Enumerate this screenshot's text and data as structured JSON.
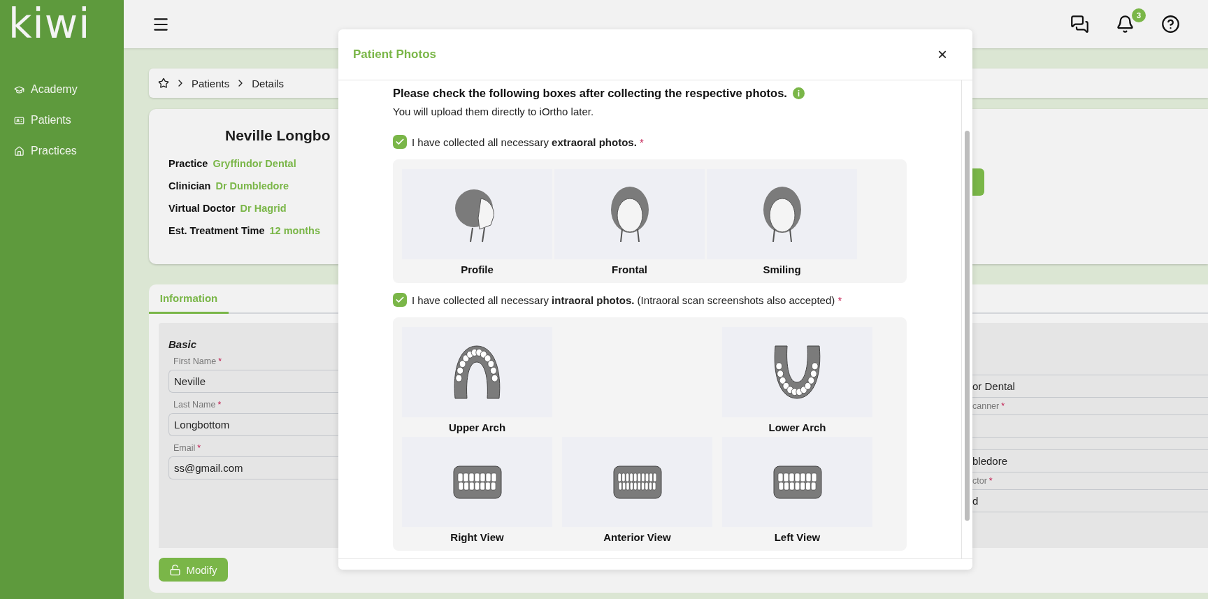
{
  "logo": "kiwi",
  "sidebar": {
    "items": [
      {
        "label": "Academy"
      },
      {
        "label": "Patients"
      },
      {
        "label": "Practices"
      }
    ]
  },
  "topbar": {
    "notification_count": "3"
  },
  "breadcrumb": [
    "Patients",
    "Details"
  ],
  "patient": {
    "name": "Neville Longbo",
    "fields": [
      {
        "label": "Practice",
        "value": "Gryffindor Dental"
      },
      {
        "label": "Clinician",
        "value": "Dr Dumbledore"
      },
      {
        "label": "Virtual Doctor",
        "value": "Dr Hagrid"
      },
      {
        "label": "Est. Treatment Time",
        "value": "12 months"
      }
    ]
  },
  "tabs": [
    {
      "label": "Information",
      "selected": true
    }
  ],
  "basic": {
    "title": "Basic",
    "fields": [
      {
        "label": "First Name",
        "required_mark": "*",
        "value": "Neville"
      },
      {
        "label": "Last Name",
        "required_mark": "*",
        "value": "Longbottom"
      },
      {
        "label": "Email",
        "required_mark": "*",
        "value": "ss@gmail.com"
      }
    ]
  },
  "right_fields": [
    {
      "value": "or Dental"
    },
    {
      "label": "canner",
      "required_mark": "*"
    },
    {
      "value": "bledore"
    },
    {
      "label": "ctor",
      "required_mark": "*",
      "value": "d"
    }
  ],
  "modify_button": "Modify",
  "modal": {
    "title": "Patient Photos",
    "close": "×",
    "heading": "Please check the following boxes after collecting the respective photos.",
    "subtext": "You will upload them directly to iOrtho later.",
    "sections": [
      {
        "checked": true,
        "text": "I have collected all necessary **extraoral photos.**",
        "required_mark": "*",
        "photos": [
          {
            "label": "Profile",
            "kind": "profile"
          },
          {
            "label": "Frontal",
            "kind": "frontal"
          },
          {
            "label": "Smiling",
            "kind": "smiling"
          }
        ]
      },
      {
        "checked": true,
        "text": "I have collected all necessary **intraoral photos.** (Intraoral scan screenshots also accepted)",
        "required_mark": "*",
        "photos": [
          {
            "label": "Upper Arch",
            "kind": "upper-arch"
          },
          {
            "label": "Lower Arch",
            "kind": "lower-arch"
          },
          {
            "label": "Right View",
            "kind": "right-view"
          },
          {
            "label": "Anterior View",
            "kind": "anterior-view"
          },
          {
            "label": "Left View",
            "kind": "left-view"
          }
        ]
      }
    ]
  }
}
